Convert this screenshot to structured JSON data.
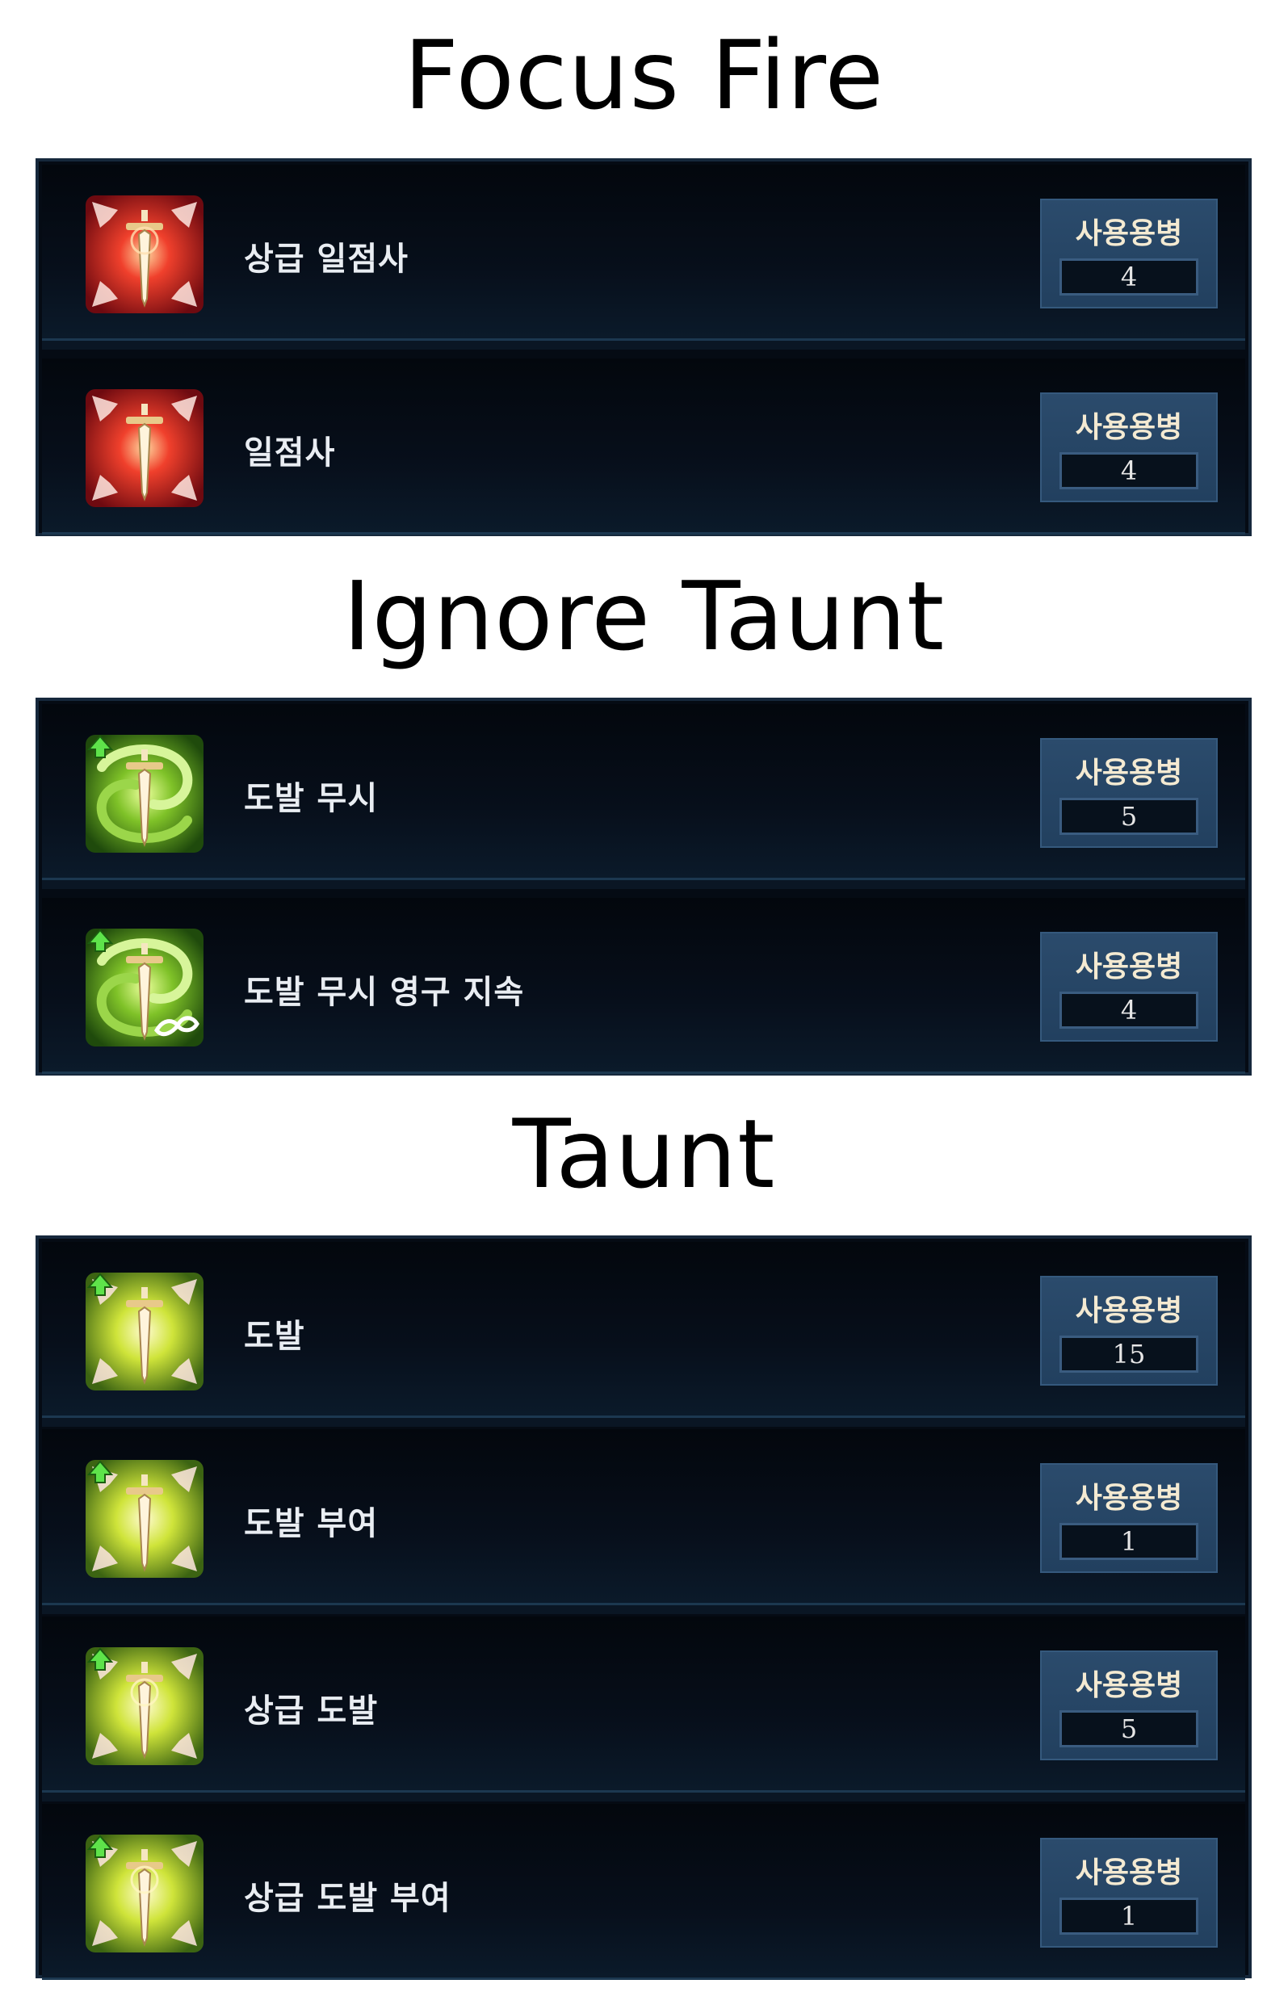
{
  "mercenary_label": "사용용병",
  "sections": [
    {
      "title": "Focus Fire",
      "skills": [
        {
          "name": "상급 일점사",
          "count": "4",
          "icon": "focus-fire-advanced-icon"
        },
        {
          "name": "일점사",
          "count": "4",
          "icon": "focus-fire-icon"
        }
      ]
    },
    {
      "title": "Ignore Taunt",
      "skills": [
        {
          "name": "도발 무시",
          "count": "5",
          "icon": "ignore-taunt-icon"
        },
        {
          "name": "도발 무시 영구 지속",
          "count": "4",
          "icon": "ignore-taunt-permanent-icon"
        }
      ]
    },
    {
      "title": "Taunt",
      "skills": [
        {
          "name": "도발",
          "count": "15",
          "icon": "taunt-icon"
        },
        {
          "name": "도발 부여",
          "count": "1",
          "icon": "grant-taunt-icon"
        },
        {
          "name": "상급 도발",
          "count": "5",
          "icon": "taunt-advanced-icon"
        },
        {
          "name": "상급 도발 부여",
          "count": "1",
          "icon": "grant-taunt-advanced-icon"
        }
      ]
    }
  ],
  "colors": {
    "focus_fire": "#d81e24",
    "ignore_taunt": "#6fb22a",
    "taunt": "#a9d42c",
    "badge": "#2b4b6c"
  }
}
